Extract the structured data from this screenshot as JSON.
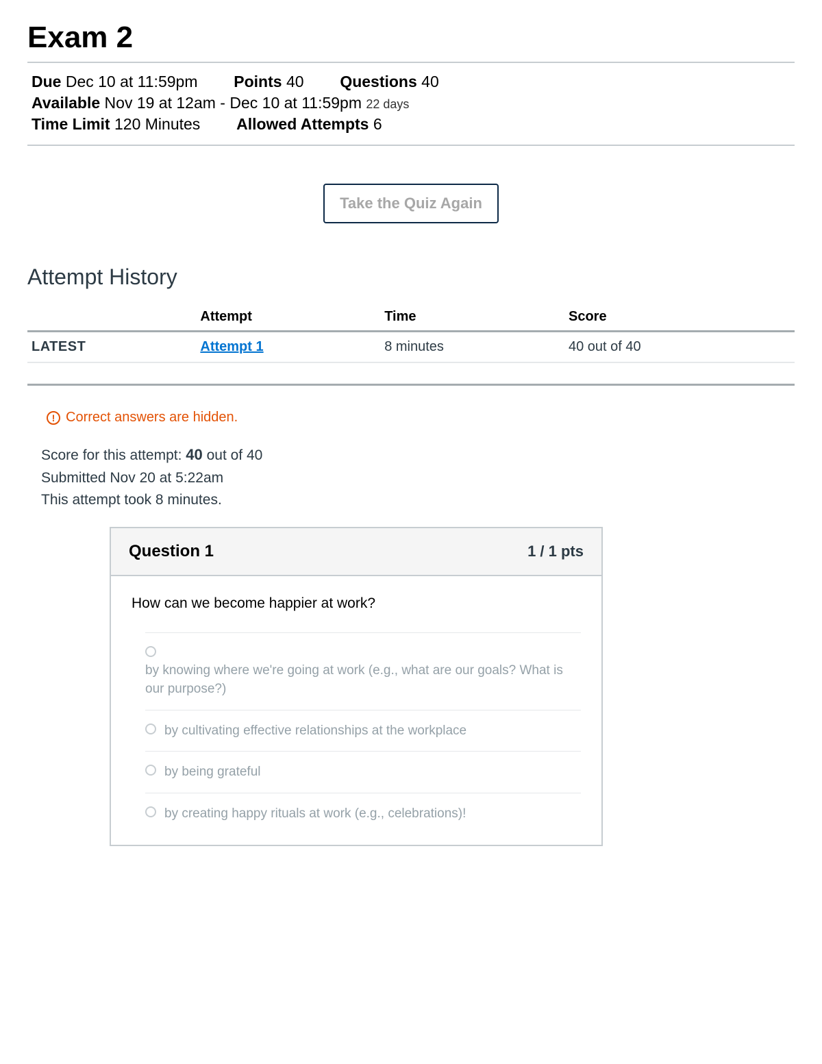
{
  "page": {
    "title": "Exam 2"
  },
  "meta": {
    "due_label": "Due",
    "due_value": "Dec 10 at 11:59pm",
    "points_label": "Points",
    "points_value": "40",
    "questions_label": "Questions",
    "questions_value": "40",
    "available_label": "Available",
    "available_value": "Nov 19 at 12am - Dec 10 at 11:59pm",
    "available_days": "22 days",
    "time_limit_label": "Time Limit",
    "time_limit_value": "120 Minutes",
    "allowed_label": "Allowed Attempts",
    "allowed_value": "6"
  },
  "take_again": "Take the Quiz Again",
  "history": {
    "title": "Attempt History",
    "headers": {
      "blank": "",
      "attempt": "Attempt",
      "time": "Time",
      "score": "Score"
    },
    "row": {
      "badge": "LATEST",
      "attempt_link": "Attempt 1",
      "time": "8 minutes",
      "score": "40 out of 40"
    }
  },
  "hidden_msg": "Correct answers are hidden.",
  "attempt_summary": {
    "line1_prefix": "Score for this attempt: ",
    "line1_score": "40",
    "line1_suffix": " out of 40",
    "line2": "Submitted Nov 20 at 5:22am",
    "line3": "This attempt took 8 minutes."
  },
  "question": {
    "title": "Question 1",
    "pts": "1 / 1 pts",
    "prompt": "How can we become happier at work?",
    "answers": [
      "by knowing where we're going at work (e.g., what are our goals? What is our purpose?)",
      "by cultivating effective relationships at the workplace",
      "by being grateful",
      "by creating happy rituals at work (e.g., celebrations)!"
    ]
  }
}
